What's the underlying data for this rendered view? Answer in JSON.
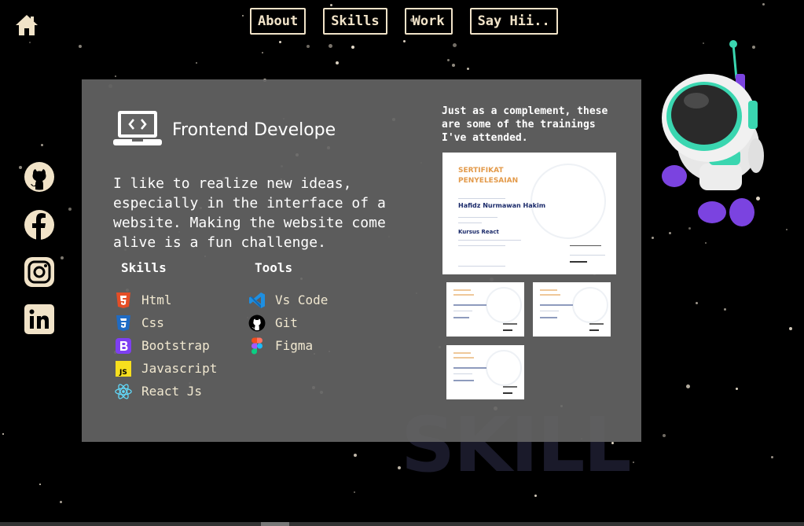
{
  "nav": {
    "home_icon": "home-icon",
    "links": [
      "About",
      "Skills",
      "Work",
      "Say Hii.."
    ]
  },
  "social": {
    "items": [
      "github-icon",
      "facebook-icon",
      "instagram-icon",
      "linkedin-icon"
    ],
    "color": "#f1e3c8"
  },
  "background_word": "SKILL",
  "panel": {
    "role": "Frontend Develope",
    "intro": "I like to realize new ideas, especially in the interface of a website. Making the website come alive is a fun challenge.",
    "skills_title": "Skills",
    "tools_title": "Tools",
    "skills": [
      {
        "label": "Html",
        "icon": "html5-icon"
      },
      {
        "label": "Css",
        "icon": "css3-icon"
      },
      {
        "label": "Bootstrap",
        "icon": "bootstrap-icon"
      },
      {
        "label": "Javascript",
        "icon": "javascript-icon"
      },
      {
        "label": "React Js",
        "icon": "react-icon"
      }
    ],
    "tools": [
      {
        "label": "Vs Code",
        "icon": "vscode-icon"
      },
      {
        "label": "Git",
        "icon": "github-icon"
      },
      {
        "label": "Figma",
        "icon": "figma-icon"
      }
    ],
    "trainings_text": "Just as a complement, these are some of the trainings I've attended."
  },
  "certificates": {
    "title_line1": "SERTIFIKAT",
    "title_line2": "PENYELESAIAN",
    "name": "Hafidz Nurmawan Hakim",
    "main_course": "Kursus React"
  },
  "colors": {
    "accent": "#f1e3c8",
    "panel": "#646464",
    "background": "#000000"
  }
}
